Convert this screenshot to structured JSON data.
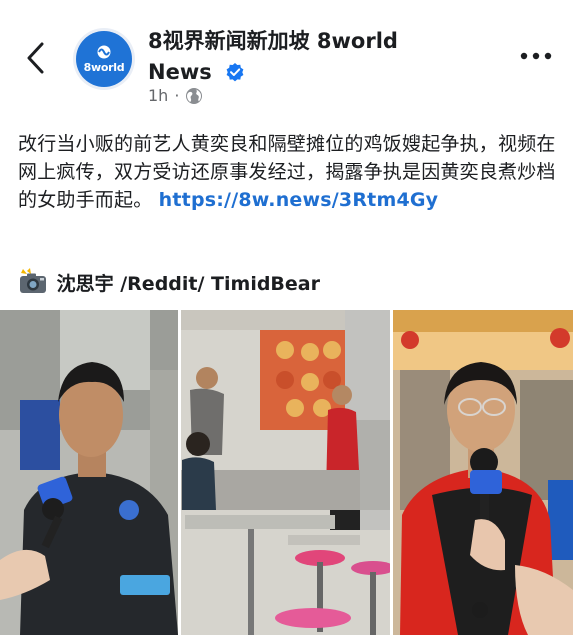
{
  "header": {
    "page_name_line1": "8视界新闻新加坡 8world",
    "page_name_line2": "News",
    "avatar_text": "8world",
    "time": "1h",
    "separator": "·",
    "audience_icon": "globe-icon",
    "verified_icon": "verified-badge-icon",
    "back_icon": "chevron-left-icon",
    "more_icon": "more-horizontal-icon"
  },
  "post": {
    "text": "改行当小贩的前艺人黄奕良和隔壁摊位的鸡饭嫂起争执，视频在网上疯传，双方受访还原事发经过，揭露争执是因黄奕良煮炒档的女助手而起。",
    "link": "https://8w.news/3Rtm4Gy",
    "credit_icon": "camera-flash-icon",
    "credit_text": "沈思宇 /Reddit/ TimidBear"
  },
  "colors": {
    "brand_blue": "#1f73d6",
    "link_blue": "#1f6fd1",
    "verified_blue": "#1877f2",
    "text_primary": "#1c1e21",
    "text_secondary": "#65676b"
  }
}
